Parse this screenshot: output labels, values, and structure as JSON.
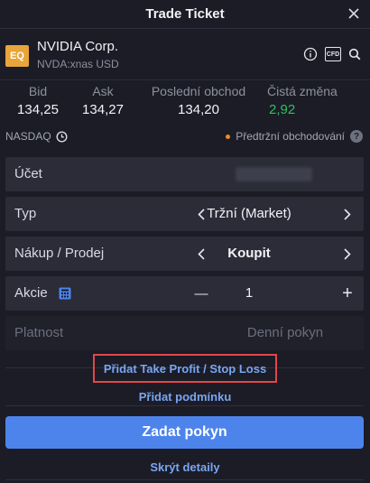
{
  "header": {
    "title": "Trade Ticket",
    "close_icon": "close-icon"
  },
  "instrument": {
    "badge": "EQ",
    "badge_color": "#e9a43a",
    "name": "NVIDIA Corp.",
    "subtitle": "NVDA:xnas USD",
    "icons": [
      "info-icon",
      "cfd-icon",
      "search-icon"
    ],
    "cfd_label": "CFD"
  },
  "quotes": {
    "bid_label": "Bid",
    "bid_value": "134,25",
    "ask_label": "Ask",
    "ask_value": "134,27",
    "last_label": "Poslední obchod",
    "last_value": "134,20",
    "net_label": "Čistá změna",
    "net_value": "2,92",
    "net_color": "#2fbf64"
  },
  "market": {
    "exchange": "NASDAQ",
    "session": "Předtržní obchodování",
    "session_dot_color": "#f08a24"
  },
  "form": {
    "account_label": "Účet",
    "type_label": "Typ",
    "type_value": "Tržní (Market)",
    "side_label": "Nákup / Prodej",
    "side_value": "Koupit",
    "qty_label": "Akcie",
    "qty_value": "1",
    "qty_minus": "—",
    "qty_plus": "+",
    "validity_label": "Platnost",
    "validity_value": "Denní pokyn"
  },
  "links": {
    "take_profit": "Přidat Take Profit / Stop Loss",
    "condition": "Přidat podmínku",
    "hide_details": "Skrýt detaily"
  },
  "submit_label": "Zadat pokyn",
  "colors": {
    "accent": "#4d84ec",
    "link": "#7aa5f2",
    "highlight": "#e0484c",
    "background": "#1b1c26"
  }
}
